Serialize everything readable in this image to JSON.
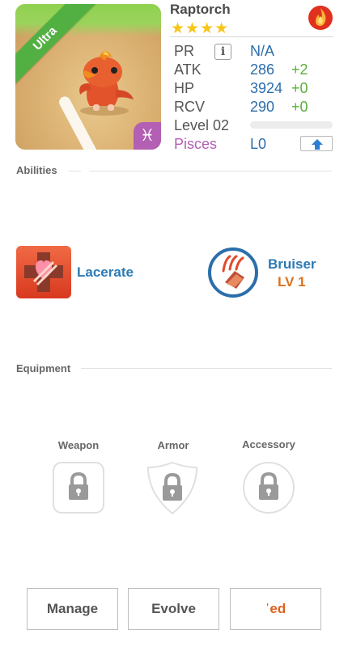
{
  "monster": {
    "name": "Raptorch",
    "rarity": "Ultra",
    "stars": "★★★★",
    "element_icon": "fire-icon",
    "zodiac_symbol": "♓"
  },
  "stats": {
    "pr": {
      "label": "PR",
      "value": "N/A"
    },
    "atk": {
      "label": "ATK",
      "value": "286",
      "bonus": "+2"
    },
    "hp": {
      "label": "HP",
      "value": "3924",
      "bonus": "+0"
    },
    "rcv": {
      "label": "RCV",
      "value": "290",
      "bonus": "+0"
    },
    "level": {
      "label": "Level 02",
      "progress": 0
    },
    "zodiac": {
      "label": "Pisces",
      "value": "L0"
    }
  },
  "abilities": {
    "title": "Abilities",
    "items": [
      {
        "name": "Lacerate",
        "icon": "lacerate-heart-icon"
      },
      {
        "name": "Bruiser",
        "level": "LV 1",
        "icon": "bruiser-claw-icon"
      }
    ]
  },
  "equipment": {
    "title": "Equipment",
    "slots": [
      {
        "label": "Weapon",
        "icon": "lock-icon"
      },
      {
        "label": "Armor",
        "icon": "lock-icon"
      },
      {
        "label": "Accessory",
        "icon": "lock-icon"
      }
    ]
  },
  "actions": {
    "manage": "Manage",
    "evolve": "Evolve",
    "feed": "ˈed"
  },
  "colors": {
    "value_blue": "#2c6eab",
    "bonus_green": "#5aaf3a",
    "zodiac_purple": "#b35fb3",
    "ability_blue": "#2c7ab5",
    "level_orange": "#e0701c",
    "star_gold": "#f5c518"
  }
}
